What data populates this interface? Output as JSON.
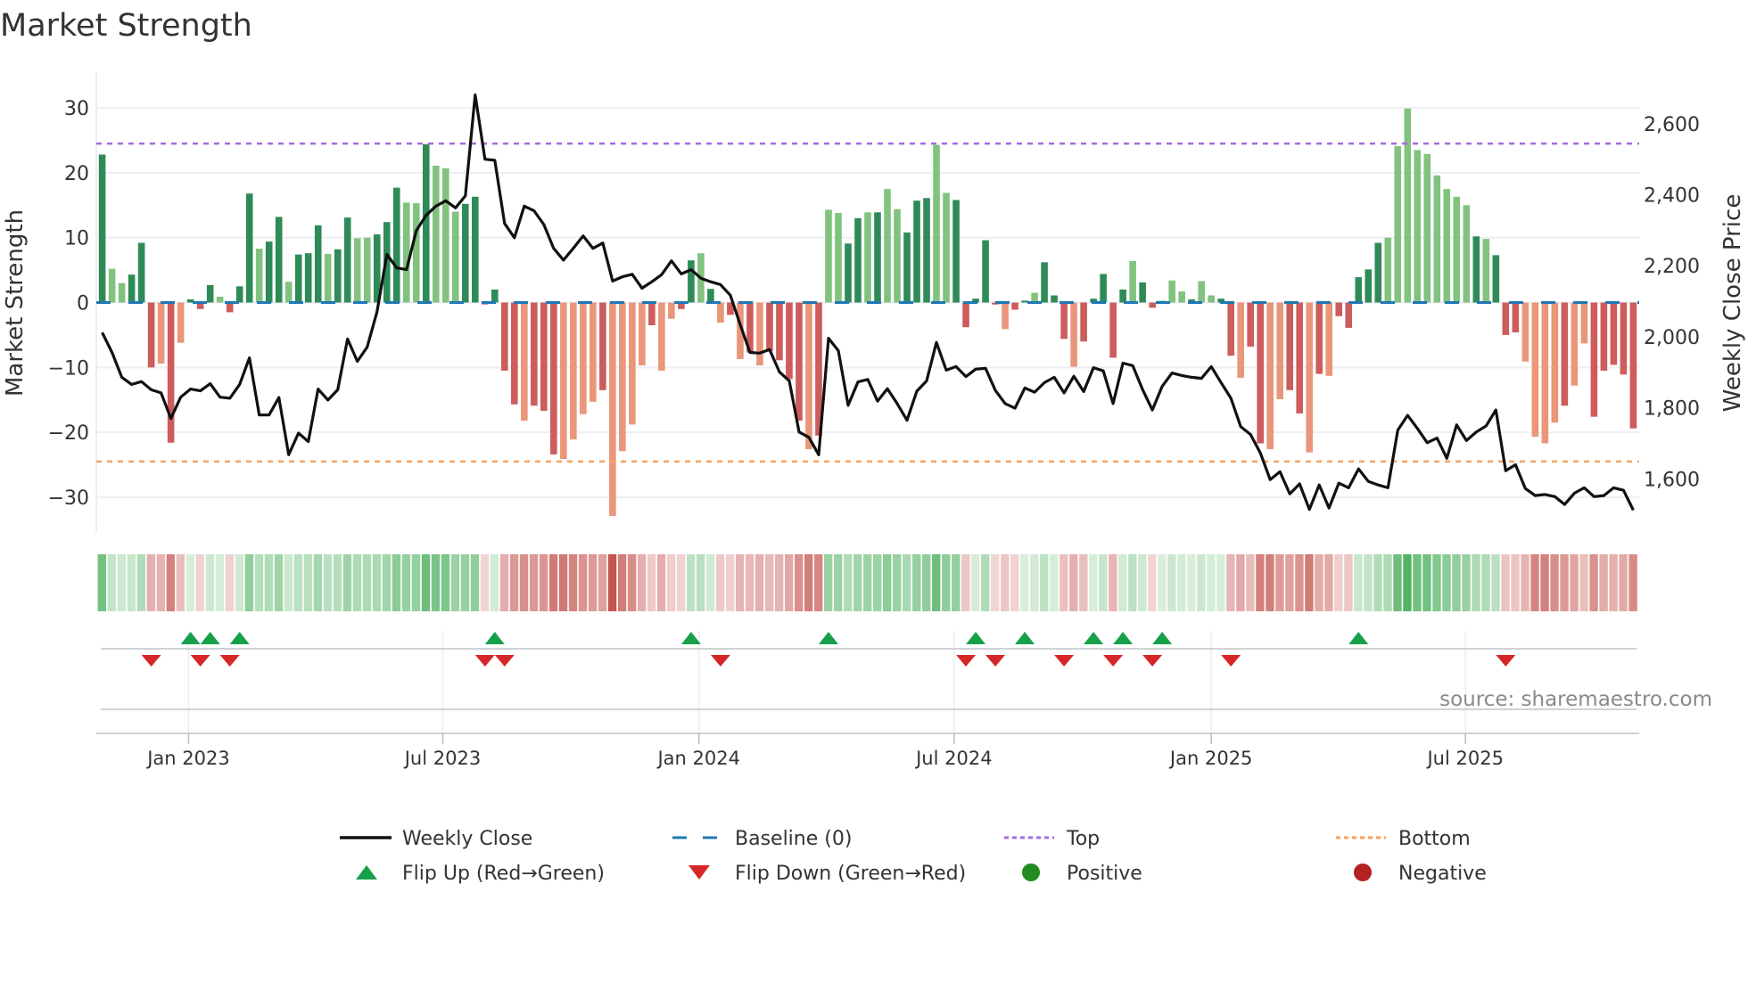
{
  "title": "Market Strength",
  "source": "source: sharemaestro.com",
  "chart_data": {
    "type": "bar",
    "title": "Market Strength",
    "ylabel": "Market Strength",
    "y2label": "Weekly Close Price",
    "ylim": [
      -35.5,
      35.5
    ],
    "y2lim": [
      1448,
      2745
    ],
    "yticks": [
      30,
      20,
      10,
      0,
      -10,
      -20,
      -30
    ],
    "ytick_labels": [
      "30",
      "20",
      "10",
      "0",
      "−10",
      "−20",
      "−30"
    ],
    "y2ticks": [
      2600,
      2400,
      2200,
      2000,
      1800,
      1600
    ],
    "y2tick_labels": [
      "2,600",
      "2,400",
      "2,200",
      "2,000",
      "1,800",
      "1,600"
    ],
    "x_unit": "week index",
    "xlim": [
      -0.6,
      156.6
    ],
    "xticks": [
      {
        "label": "Jan 2023",
        "week": 8.8
      },
      {
        "label": "Jul 2023",
        "week": 34.7
      },
      {
        "label": "Jan 2024",
        "week": 60.8
      },
      {
        "label": "Jul 2024",
        "week": 86.8
      },
      {
        "label": "Jan 2025",
        "week": 113.0
      },
      {
        "label": "Jul 2025",
        "week": 138.9
      }
    ],
    "top_level": 24.5,
    "bottom_level": -24.5,
    "baseline": 0,
    "grid": true,
    "strength": [
      22.8,
      5.2,
      3.0,
      4.3,
      9.2,
      -10.0,
      -9.4,
      -21.6,
      -6.2,
      0.5,
      -1.0,
      2.7,
      0.9,
      -1.5,
      2.5,
      16.8,
      8.3,
      9.4,
      13.2,
      3.2,
      7.4,
      7.6,
      11.9,
      7.5,
      8.2,
      13.1,
      9.9,
      10.0,
      10.5,
      12.4,
      17.7,
      15.4,
      15.3,
      24.4,
      21.1,
      20.7,
      14.0,
      15.2,
      16.3,
      -0.3,
      2.0,
      -10.5,
      -15.7,
      -18.2,
      -15.9,
      -16.7,
      -23.4,
      -24.1,
      -21.1,
      -17.2,
      -15.3,
      -13.5,
      -32.9,
      -22.9,
      -18.8,
      -9.7,
      -3.5,
      -10.5,
      -2.5,
      -1.0,
      6.5,
      7.6,
      2.1,
      -3.1,
      -1.9,
      -8.7,
      -7.7,
      -9.7,
      -7.5,
      -8.9,
      -11.8,
      -18.2,
      -22.6,
      -20.5,
      14.3,
      13.8,
      9.1,
      13.0,
      13.9,
      13.9,
      17.5,
      14.4,
      10.8,
      15.7,
      16.1,
      24.3,
      16.9,
      15.8,
      -3.8,
      0.6,
      9.6,
      -0.3,
      -4.1,
      -1.1,
      0.3,
      1.5,
      6.2,
      1.1,
      -5.6,
      -9.9,
      -6.0,
      0.6,
      4.4,
      -8.5,
      2.0,
      6.4,
      3.1,
      -0.8,
      0.3,
      3.4,
      1.7,
      0.5,
      3.3,
      1.1,
      0.6,
      -8.2,
      -11.6,
      -6.8,
      -21.7,
      -22.6,
      -14.9,
      -13.5,
      -17.1,
      -23.1,
      -11.0,
      -11.3,
      -2.1,
      -3.9,
      3.9,
      5.1,
      9.2,
      10.0,
      24.1,
      29.9,
      23.5,
      22.9,
      19.6,
      17.5,
      16.3,
      15.0,
      10.2,
      9.8,
      7.3,
      -5.0,
      -4.6,
      -9.1,
      -20.7,
      -21.7,
      -18.5,
      -15.9,
      -12.8,
      -6.3,
      -17.6,
      -10.5,
      -9.6,
      -11.1,
      -19.4
    ],
    "shade": "dlldddldldddldddlddldddlddlldddlldlllddddddldddlllldlllldllddldldldlddddldllddldlldddlldddddlddldddldddddlddllldllddldd llddldldddddllllllllldldddlllldlldd",
    "weekly_close": [
      2012,
      1956,
      1886,
      1866,
      1874,
      1851,
      1842,
      1770,
      1830,
      1853,
      1848,
      1868,
      1830,
      1827,
      1866,
      1941,
      1780,
      1780,
      1829,
      1668,
      1729,
      1705,
      1853,
      1822,
      1851,
      1994,
      1931,
      1971,
      2070,
      2232,
      2194,
      2189,
      2299,
      2342,
      2368,
      2383,
      2363,
      2397,
      2681,
      2500,
      2497,
      2319,
      2279,
      2368,
      2355,
      2316,
      2249,
      2216,
      2249,
      2284,
      2249,
      2264,
      2157,
      2169,
      2176,
      2137,
      2155,
      2175,
      2214,
      2177,
      2189,
      2165,
      2155,
      2147,
      2117,
      2035,
      1956,
      1954,
      1964,
      1901,
      1876,
      1732,
      1717,
      1668,
      1996,
      1961,
      1807,
      1873,
      1880,
      1819,
      1854,
      1812,
      1765,
      1847,
      1876,
      1984,
      1906,
      1916,
      1888,
      1909,
      1911,
      1849,
      1812,
      1799,
      1856,
      1844,
      1871,
      1886,
      1842,
      1889,
      1846,
      1913,
      1904,
      1812,
      1926,
      1919,
      1852,
      1794,
      1861,
      1898,
      1891,
      1886,
      1883,
      1916,
      1871,
      1827,
      1747,
      1725,
      1673,
      1598,
      1620,
      1558,
      1586,
      1514,
      1583,
      1518,
      1588,
      1575,
      1628,
      1593,
      1583,
      1575,
      1737,
      1779,
      1742,
      1702,
      1715,
      1658,
      1752,
      1708,
      1732,
      1749,
      1794,
      1623,
      1640,
      1573,
      1553,
      1556,
      1550,
      1528,
      1560,
      1575,
      1550,
      1553,
      1575,
      1568,
      1512
    ],
    "flip_up_weeks": [
      9,
      11,
      14,
      40,
      60,
      74,
      89,
      94,
      101,
      104,
      108,
      128
    ],
    "flip_down_weeks": [
      5,
      10,
      13,
      39,
      41,
      63,
      88,
      91,
      98,
      103,
      107,
      115,
      143
    ],
    "legend": {
      "placement": "bottom",
      "items": [
        {
          "label": "Weekly Close",
          "kind": "line",
          "color": "#111111"
        },
        {
          "label": "Baseline (0)",
          "kind": "dash",
          "color": "#1f77b4"
        },
        {
          "label": "Top",
          "kind": "dot",
          "color": "#a66be0"
        },
        {
          "label": "Bottom",
          "kind": "dot",
          "color": "#f4a261"
        },
        {
          "label": "Flip Up (Red→Green)",
          "kind": "up",
          "color": "#17a04a"
        },
        {
          "label": "Flip Down (Green→Red)",
          "kind": "down",
          "color": "#d62728"
        },
        {
          "label": "Positive",
          "kind": "circle",
          "color": "#228b22"
        },
        {
          "label": "Negative",
          "kind": "circle",
          "color": "#b22222"
        }
      ]
    },
    "colors": {
      "pos_dark": "#2e8b57",
      "pos_light": "#82c27f",
      "neg_dark": "#cd5c5c",
      "neg_light": "#e9967a",
      "line": "#111111",
      "baseline": "#1f77b4",
      "top": "#a66be0",
      "bottom": "#f4a261",
      "flip_up": "#17a04a",
      "flip_down": "#d62728"
    }
  }
}
